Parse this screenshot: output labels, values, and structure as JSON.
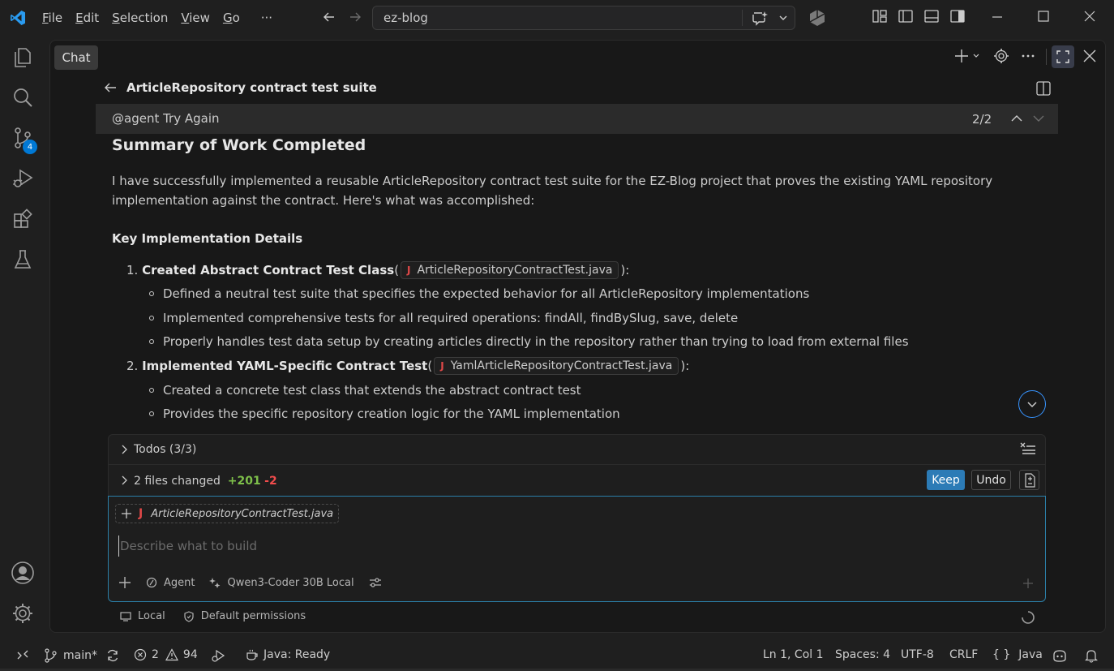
{
  "window": {
    "search_text": "ez-blog",
    "menu": [
      "File",
      "Edit",
      "Selection",
      "View",
      "Go",
      "···"
    ],
    "menu_underline": [
      "F",
      "E",
      "S",
      "V",
      "G",
      ""
    ]
  },
  "activity_bar": {
    "source_control_badge": "4"
  },
  "chat": {
    "tab_label": "Chat",
    "session_title": "ArticleRepository contract test suite",
    "request_text": "@agent Try Again",
    "request_counter": "2/2",
    "summary_heading": "Summary of Work Completed",
    "intro": "I have successfully implemented a reusable ArticleRepository contract test suite for the EZ-Blog project that proves the existing YAML repository implementation against the contract. Here's what was accomplished:",
    "key_heading": "Key Implementation Details",
    "items": [
      {
        "number": "1.",
        "title": "Created Abstract Contract Test Class",
        "open": " (",
        "file": "ArticleRepositoryContractTest.java",
        "close": "):",
        "bullets": [
          "Defined a neutral test suite that specifies the expected behavior for all ArticleRepository implementations",
          "Implemented comprehensive tests for all required operations: findAll, findBySlug, save, delete",
          "Properly handles test data setup by creating articles directly in the repository rather than trying to load from external files"
        ]
      },
      {
        "number": "2.",
        "title": "Implemented YAML-Specific Contract Test",
        "open": " (",
        "file": "YamlArticleRepositoryContractTest.java",
        "close": "):",
        "bullets": [
          "Created a concrete test class that extends the abstract contract test",
          "Provides the specific repository creation logic for the YAML implementation"
        ]
      }
    ],
    "java_glyph": "J"
  },
  "input_area": {
    "todos_label": "Todos (3/3)",
    "files_changed_label": "2 files changed",
    "additions": "+201",
    "deletions": "-2",
    "keep_label": "Keep",
    "undo_label": "Undo",
    "attachment": "ArticleRepositoryContractTest.java",
    "placeholder": "Describe what to build",
    "mode_label": "Agent",
    "model_label": "Qwen3-Coder 30B Local",
    "location_label": "Local",
    "permissions_label": "Default permissions"
  },
  "status_bar": {
    "branch": "main*",
    "errors": "2",
    "warnings": "94",
    "java_status": "Java: Ready",
    "position": "Ln 1, Col 1",
    "spaces": "Spaces: 4",
    "encoding": "UTF-8",
    "eol": "CRLF",
    "language": "Java",
    "language_braces": "{ }"
  },
  "colors": {
    "accent": "#0078d4",
    "keep_button": "#2c7bb6",
    "additions": "#7ec04a",
    "deletions": "#f14c4c",
    "java_icon": "#e04848"
  }
}
